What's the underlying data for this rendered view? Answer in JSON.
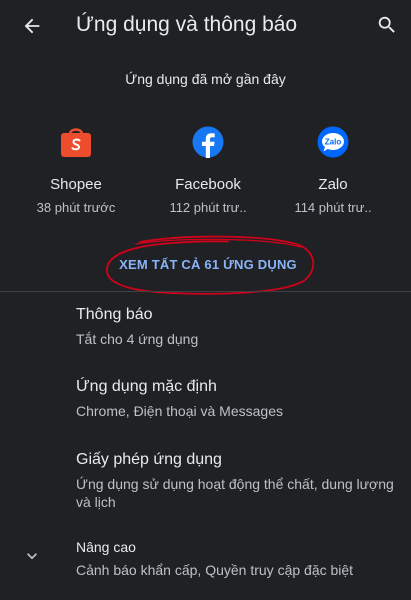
{
  "header": {
    "title": "Ứng dụng và thông báo",
    "back_icon": "arrow-left-icon",
    "search_icon": "search-icon"
  },
  "recent": {
    "title": "Ứng dụng đã mở gần đây",
    "apps": [
      {
        "name": "Shopee",
        "time": "38 phút trước",
        "icon": "shopee-icon",
        "color": "#ee4d2d"
      },
      {
        "name": "Facebook",
        "time": "112 phút trư..",
        "icon": "facebook-icon",
        "color": "#1877f2"
      },
      {
        "name": "Zalo",
        "time": "114 phút trư..",
        "icon": "zalo-icon",
        "color": "#0068ff"
      }
    ],
    "see_all_label": "XEM TẤT CẢ 61 ỨNG DỤNG",
    "annotation_color": "#d0021b"
  },
  "settings": [
    {
      "title": "Thông báo",
      "subtitle": "Tắt cho 4 ứng dụng"
    },
    {
      "title": "Ứng dụng mặc định",
      "subtitle": "Chrome, Điện thoại và Messages"
    },
    {
      "title": "Giấy phép ứng dụng",
      "subtitle": "Ứng dụng sử dụng hoạt động thể chất, dung lượng và lịch"
    },
    {
      "title": "Nâng cao",
      "subtitle": "Cảnh báo khẩn cấp, Quyền truy cập đặc biệt",
      "icon": "chevron-down-icon"
    }
  ],
  "colors": {
    "background": "#202124",
    "text_primary": "#e8eaed",
    "text_secondary": "#bdc1c6",
    "accent": "#8ab4f8",
    "divider": "#3c4043"
  }
}
